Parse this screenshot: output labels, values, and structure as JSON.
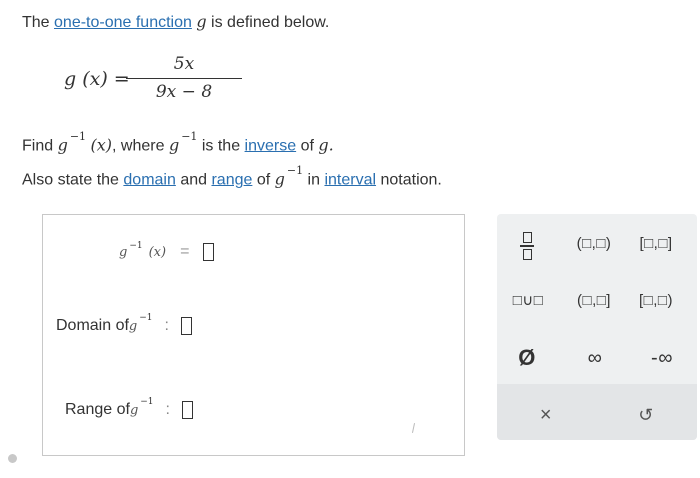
{
  "question": {
    "line1_pre": "The ",
    "line1_link": "one-to-one function",
    "line1_var": "g",
    "line1_post": " is defined below.",
    "formula": {
      "lhs": "g (x) =",
      "numerator": "5x",
      "denominator": "9x − 8"
    },
    "line3_pre": "Find ",
    "line3_g": "g",
    "line3_sup": "−1",
    "line3_x": "(x)",
    "line3_mid": ", where ",
    "line3_g2": "g",
    "line3_sup2": "−1",
    "line3_is": " is the ",
    "line3_link": "inverse",
    "line3_of": " of ",
    "line3_g3": "g.",
    "line4_pre": "Also state the ",
    "line4_link1": "domain",
    "line4_and": " and ",
    "line4_link2": "range",
    "line4_of": " of ",
    "line4_g": "g",
    "line4_sup": "−1",
    "line4_in": " in ",
    "line4_link3": "interval",
    "line4_post": " notation."
  },
  "answer": {
    "ginv_g": "g",
    "ginv_sup": "−1",
    "ginv_x": "(x)",
    "equals": "=",
    "domain_label": "Domain of ",
    "range_label": "Range of ",
    "g": "g",
    "sup": "−1",
    "colon": ":"
  },
  "palette": {
    "open_interval": "(□,□)",
    "closed_interval": "[□,□]",
    "union": "□∪□",
    "right_closed": "(□,□]",
    "left_closed": "[□,□)",
    "empty_set": "Ø",
    "infinity": "∞",
    "neg_infinity": "-∞",
    "clear": "×",
    "undo": "↺"
  }
}
